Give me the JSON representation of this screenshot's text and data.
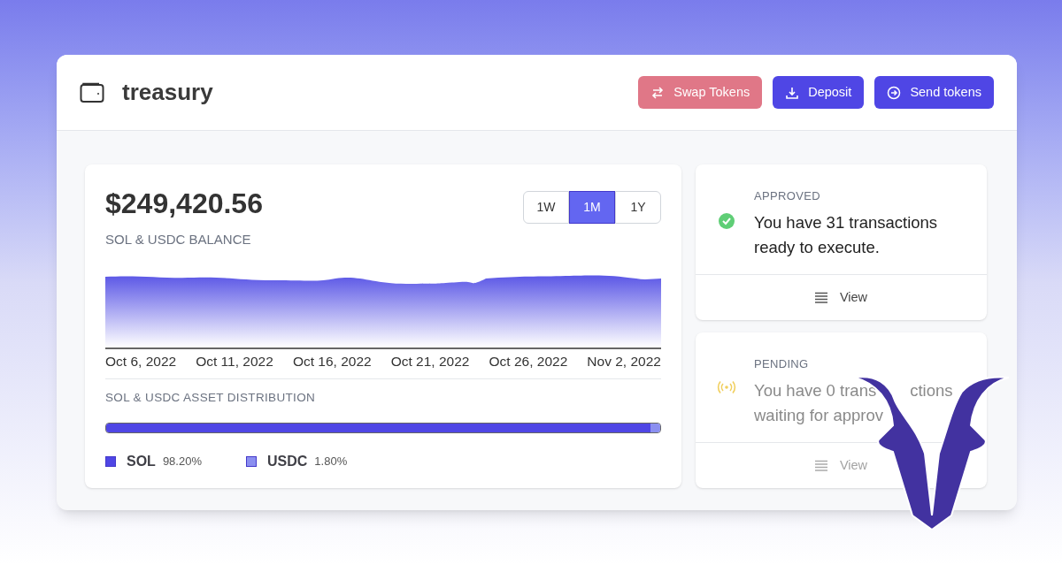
{
  "header": {
    "title": "treasury",
    "buttons": [
      {
        "label": "Swap Tokens",
        "kind": "swap",
        "disabled": true
      },
      {
        "label": "Deposit",
        "kind": "deposit",
        "disabled": false
      },
      {
        "label": "Send tokens",
        "kind": "send",
        "disabled": false
      }
    ]
  },
  "balance": {
    "amount": "$249,420.56",
    "caption": "SOL & USDC BALANCE",
    "ranges": [
      {
        "label": "1W",
        "selected": false
      },
      {
        "label": "1M",
        "selected": true
      },
      {
        "label": "1Y",
        "selected": false
      }
    ],
    "chart": {
      "kind": "picture",
      "x_labels": [
        "Oct 6, 2022",
        "Oct 11, 2022",
        "Oct 16, 2022",
        "Oct 21, 2022",
        "Oct 26, 2022",
        "Nov 2, 2022"
      ]
    }
  },
  "distribution": {
    "title": "SOL & USDC ASSET DISTRIBUTION",
    "assets": [
      {
        "name": "SOL",
        "share": "98.20%",
        "level": 0.982,
        "color": "#4f46e5"
      },
      {
        "name": "USDC",
        "share": "1.80%",
        "level": 0.018,
        "color": "#8b8ff0"
      }
    ]
  },
  "status_cards": [
    {
      "kind": "approved",
      "label": "APPROVED",
      "lines": [
        "You have 31 transactions",
        "ready to execute."
      ],
      "action": "View",
      "disabled": false
    },
    {
      "kind": "pending",
      "label": "PENDING",
      "lines": [
        "You have 0 trans",
        "waiting for approv"
      ],
      "hidden_tail": "ctions",
      "action": "View",
      "disabled": true
    }
  ]
}
